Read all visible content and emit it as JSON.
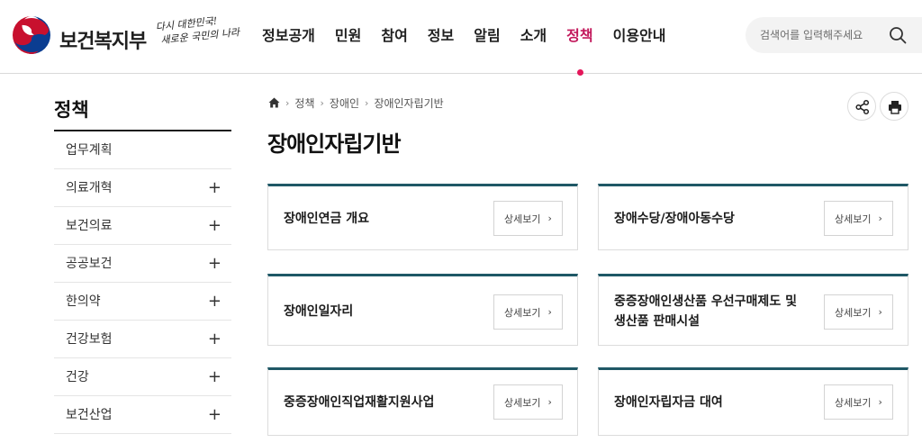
{
  "header": {
    "ministry_name": "보건복지부",
    "slogan": [
      "다시 대한민국!",
      "새로운 국민의 나라"
    ],
    "search_placeholder": "검색어를 입력해주세요",
    "accent_color": "#c2185b",
    "nav": [
      {
        "label": "정보공개",
        "active": false
      },
      {
        "label": "민원",
        "active": false
      },
      {
        "label": "참여",
        "active": false
      },
      {
        "label": "정보",
        "active": false
      },
      {
        "label": "알림",
        "active": false
      },
      {
        "label": "소개",
        "active": false
      },
      {
        "label": "정책",
        "active": true
      },
      {
        "label": "이용안내",
        "active": false
      }
    ]
  },
  "sidebar": {
    "title": "정책",
    "items": [
      {
        "label": "업무계획",
        "expandable": false
      },
      {
        "label": "의료개혁",
        "expandable": true
      },
      {
        "label": "보건의료",
        "expandable": true
      },
      {
        "label": "공공보건",
        "expandable": true
      },
      {
        "label": "한의약",
        "expandable": true
      },
      {
        "label": "건강보험",
        "expandable": true
      },
      {
        "label": "건강",
        "expandable": true
      },
      {
        "label": "보건산업",
        "expandable": true
      }
    ],
    "expand_symbol": "+"
  },
  "breadcrumb": {
    "home_icon": "home-icon",
    "items": [
      "정책",
      "장애인",
      "장애인자립기반"
    ],
    "separator": "›"
  },
  "page_title": "장애인자립기반",
  "cards": [
    {
      "title": "장애인연금 개요",
      "button": "상세보기"
    },
    {
      "title": "장애수당/장애아동수당",
      "button": "상세보기"
    },
    {
      "title": "장애인일자리",
      "button": "상세보기"
    },
    {
      "title": "중증장애인생산품 우선구매제도 및 생산품 판매시설",
      "button": "상세보기"
    },
    {
      "title": "중증장애인직업재활지원사업",
      "button": "상세보기"
    },
    {
      "title": "장애인자립자금 대여",
      "button": "상세보기"
    }
  ],
  "card_chevron": "›",
  "colors": {
    "card_top_border": "#1f5866",
    "active_dot": "#e4165a"
  }
}
